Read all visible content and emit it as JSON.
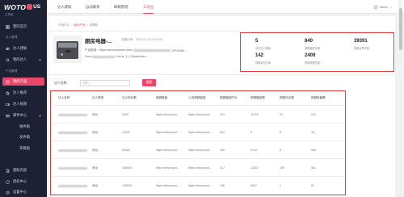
{
  "logo": {
    "text_left": "WOTO",
    "text_right": "US"
  },
  "sidebar": {
    "workspace_label": "工作台",
    "sections": [
      "达人管理",
      "产品管理"
    ],
    "items": [
      {
        "label": "我的首页",
        "icon": "home-icon"
      },
      {
        "label": "达人建联",
        "icon": "link-icon"
      },
      {
        "label": "我的达人",
        "icon": "user-icon",
        "expandable": true
      },
      {
        "label": "我的产品",
        "icon": "box-icon",
        "active": true
      },
      {
        "label": "达人推荐",
        "icon": "star-icon"
      },
      {
        "label": "达人视频",
        "icon": "video-icon"
      },
      {
        "label": "邮件中心",
        "icon": "mail-icon",
        "expandable": true
      },
      {
        "label": "收件箱"
      },
      {
        "label": "发件箱"
      },
      {
        "label": "草稿箱"
      },
      {
        "label": "建联内容",
        "icon": "doc-icon"
      },
      {
        "label": "授权中心",
        "icon": "shield-icon"
      },
      {
        "label": "设置中心",
        "icon": "gear-icon"
      }
    ]
  },
  "topnav": {
    "items": [
      "达人建联",
      "自动联系",
      "邮箱管理",
      "工作台"
    ],
    "active_index": 3,
    "user": "admin"
  },
  "breadcrumb": {
    "items": [
      "产品中心",
      "我的产品",
      "详情页"
    ],
    "separator": "/"
  },
  "product": {
    "title": "厨房电器-...",
    "created": "创建时间：2022-01-22 01:00:00",
    "link_line1": "产品链接：https://www.amazon.com/",
    "link_line1_tail": "-DP-B08X...",
    "link_line2_head": "Soun",
    "link_line2_tail": "/ref=sr_1_1?keywords=..."
  },
  "stats": [
    {
      "value": "5",
      "label": "合作达人数量"
    },
    {
      "value": "840",
      "label": "视频播放总量"
    },
    {
      "value": "39391",
      "label": "视频点赞总量"
    },
    {
      "value": "142",
      "label": "视频评论总量"
    },
    {
      "value": "2409",
      "label": "视频收藏总量"
    }
  ],
  "search": {
    "label": "达人名称：",
    "placeholder": "请输入",
    "button": "搜索"
  },
  "table": {
    "columns": [
      "达人名称",
      "达人类型",
      "达人粉丝数",
      "视频链接",
      "上传视频链接",
      "视频播放时长",
      "视频播放数",
      "视频评论数",
      "视频收藏数"
    ],
    "rows": [
      {
        "type": "美妆",
        "fans": "3500",
        "video_link": "https://www.yout...",
        "upload_link": "https://www.yout...",
        "duration": "241",
        "plays": "11379",
        "comments": "21",
        "favorites": "541"
      },
      {
        "type": "美妆",
        "fans": "11500",
        "video_link": "https://www.yout...",
        "upload_link": "https://www.yout...",
        "duration": "541",
        "plays": "6",
        "comments": "8",
        "favorites": "16"
      },
      {
        "type": "美妆",
        "fans": "52500",
        "video_link": "https://www.yout...",
        "upload_link": "https://www.yout...",
        "duration": "190",
        "plays": "5742",
        "comments": "8",
        "favorites": "308"
      },
      {
        "type": "美妆",
        "fans": "168000",
        "video_link": "https://www.yout...",
        "upload_link": "https://www.yout...",
        "duration": "217",
        "plays": "12637",
        "comments": "159",
        "favorites": "561"
      },
      {
        "type": "美妆",
        "fans": "135000",
        "video_link": "https://www.yout...",
        "upload_link": "https://www.yout...",
        "duration": "198",
        "plays": "4647",
        "comments": "1",
        "favorites": "81"
      }
    ]
  },
  "colors": {
    "brand": "#e9486a",
    "sidebar_bg": "#1c2233",
    "highlight_border": "#e53b3b",
    "page_bg": "#f0f2f5"
  }
}
